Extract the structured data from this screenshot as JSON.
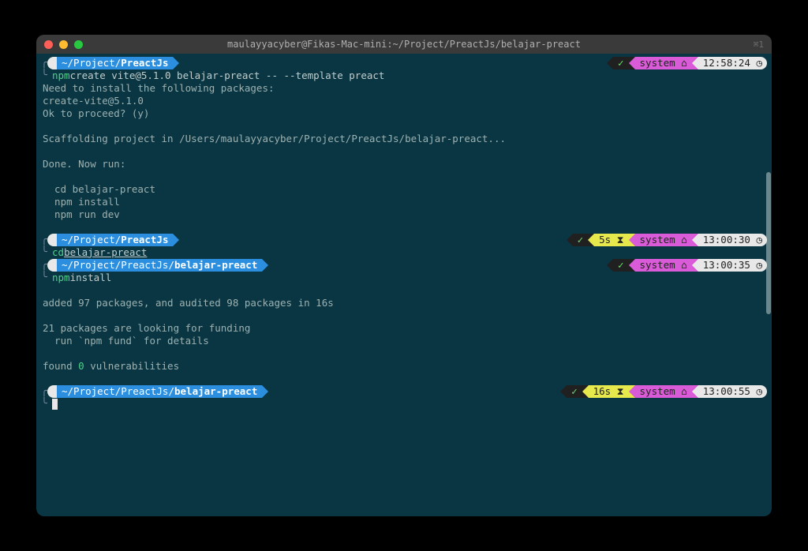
{
  "titlebar": {
    "title": "maulayyacyber@Fikas-Mac-mini:~/Project/PreactJs/belajar-preact",
    "tab_indicator": "⌘1"
  },
  "icons": {
    "apple": "",
    "folder": "",
    "house": "⌂",
    "hourglass": "⧗",
    "clock": "◷",
    "check": "✓"
  },
  "blocks": [
    {
      "path_prefix": "~/Project/",
      "path_bold": "PreactJs",
      "duration": "",
      "system": "system",
      "time": "12:58:24",
      "cmd_prefix": "npm",
      "cmd_rest": " create vite@5.1.0 belajar-preact -- --template preact",
      "underline": false,
      "output": [
        "Need to install the following packages:",
        "create-vite@5.1.0",
        "Ok to proceed? (y)",
        "",
        "Scaffolding project in /Users/maulayyacyber/Project/PreactJs/belajar-preact...",
        "",
        "Done. Now run:",
        "",
        "  cd belajar-preact",
        "  npm install",
        "  npm run dev",
        ""
      ]
    },
    {
      "path_prefix": "~/Project/",
      "path_bold": "PreactJs",
      "duration": "5s",
      "system": "system",
      "time": "13:00:30",
      "cmd_prefix": "cd",
      "cmd_rest": "belajar-preact",
      "underline": true,
      "output": []
    },
    {
      "path_prefix": "~/Project/PreactJs/",
      "path_bold": "belajar-preact",
      "duration": "",
      "system": "system",
      "time": "13:00:35",
      "cmd_prefix": "npm",
      "cmd_rest": " install",
      "underline": false,
      "output": [
        "",
        "added 97 packages, and audited 98 packages in 16s",
        "",
        "21 packages are looking for funding",
        "  run `npm fund` for details",
        ""
      ],
      "output_special": "found |0| vulnerabilities"
    },
    {
      "path_prefix": "~/Project/PreactJs/",
      "path_bold": "belajar-preact",
      "duration": "16s",
      "system": "system",
      "time": "13:00:55",
      "cmd_prefix_blank": true,
      "cursor": true
    }
  ]
}
